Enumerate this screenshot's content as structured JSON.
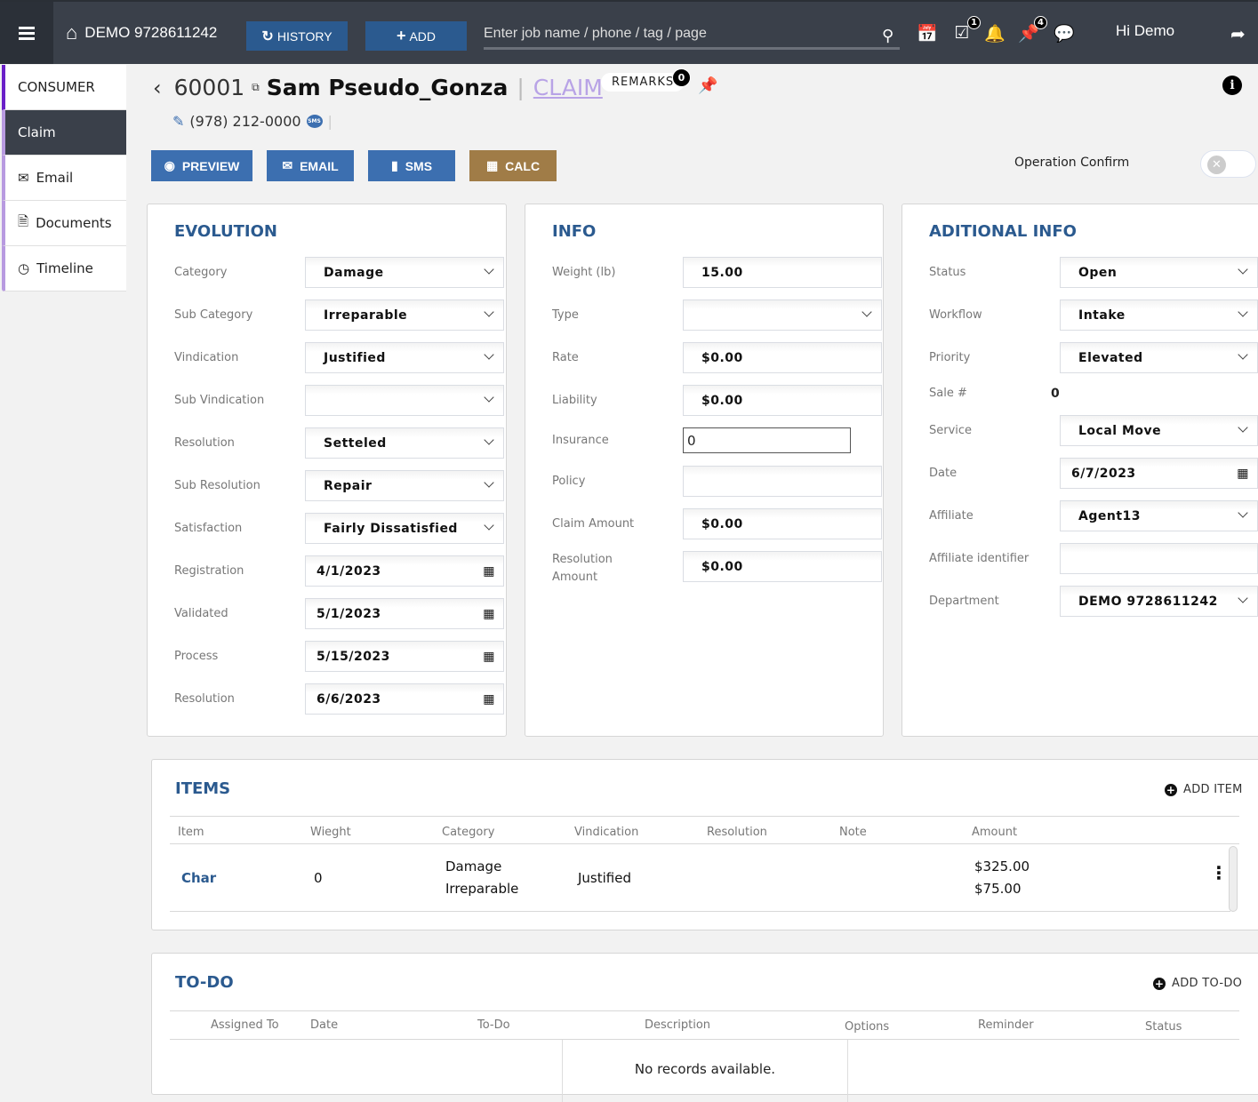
{
  "topbar": {
    "brand": "DEMO 9728611242",
    "history_label": "HISTORY",
    "add_label": "ADD",
    "search_placeholder": "Enter job name / phone / tag / page",
    "tasks_badge": "1",
    "pins_badge": "4",
    "greeting": "Hi Demo"
  },
  "sidebar": {
    "items": [
      {
        "label": "CONSUMER"
      },
      {
        "label": "Claim",
        "active": true
      },
      {
        "label": "Email",
        "icon": "envelope-icon"
      },
      {
        "label": "Documents",
        "icon": "document-icon"
      },
      {
        "label": "Timeline",
        "icon": "clock-icon"
      }
    ]
  },
  "header": {
    "job_number": "60001",
    "customer_name": "Sam Pseudo_Gonza",
    "section": "CLAIM",
    "remarks_label": "REMARKS",
    "remarks_count": "0",
    "phone": "(978) 212-0000",
    "sms_badge": "SMS"
  },
  "actions": {
    "preview": "PREVIEW",
    "email": "EMAIL",
    "sms": "SMS",
    "calc": "CALC",
    "operation_confirm_label": "Operation Confirm",
    "operation_confirm_on": false
  },
  "evolution": {
    "title": "EVOLUTION",
    "fields": [
      {
        "label": "Category",
        "value": "Damage",
        "type": "select"
      },
      {
        "label": "Sub Category",
        "value": "Irreparable",
        "type": "select"
      },
      {
        "label": "Vindication",
        "value": "Justified",
        "type": "select"
      },
      {
        "label": "Sub Vindication",
        "value": "",
        "type": "select"
      },
      {
        "label": "Resolution",
        "value": "Setteled",
        "type": "select"
      },
      {
        "label": "Sub Resolution",
        "value": "Repair",
        "type": "select"
      },
      {
        "label": "Satisfaction",
        "value": "Fairly Dissatisfied",
        "type": "select"
      },
      {
        "label": "Registration",
        "value": "4/1/2023",
        "type": "date"
      },
      {
        "label": "Validated",
        "value": "5/1/2023",
        "type": "date"
      },
      {
        "label": "Process",
        "value": "5/15/2023",
        "type": "date"
      },
      {
        "label": "Resolution",
        "value": "6/6/2023",
        "type": "date"
      }
    ]
  },
  "info": {
    "title": "INFO",
    "weight_label": "Weight (lb)",
    "weight": "15.00",
    "type_label": "Type",
    "type": "",
    "rate_label": "Rate",
    "rate": "$0.00",
    "liability_label": "Liability",
    "liability": "$0.00",
    "insurance_label": "Insurance",
    "insurance": "0",
    "policy_label": "Policy",
    "policy": "",
    "claim_amount_label": "Claim Amount",
    "claim_amount": "$0.00",
    "resolution_amount_label": "Resolution Amount",
    "resolution_amount": "$0.00"
  },
  "additional": {
    "title": "ADITIONAL INFO",
    "status_label": "Status",
    "status": "Open",
    "workflow_label": "Workflow",
    "workflow": "Intake",
    "priority_label": "Priority",
    "priority": "Elevated",
    "sale_label": "Sale #",
    "sale": "0",
    "service_label": "Service",
    "service": "Local Move",
    "date_label": "Date",
    "date": "6/7/2023",
    "affiliate_label": "Affiliate",
    "affiliate": "Agent13",
    "affiliate_id_label": "Affiliate identifier",
    "affiliate_id": "",
    "department_label": "Department",
    "department": "DEMO 9728611242"
  },
  "items": {
    "title": "ITEMS",
    "add_label": "ADD ITEM",
    "columns": [
      "Item",
      "Wieght",
      "Category",
      "Vindication",
      "Resolution",
      "Note",
      "Amount"
    ],
    "rows": [
      {
        "item": "Char",
        "weight": "0",
        "category": "Damage",
        "subcategory": "Irreparable",
        "vindication": "Justified",
        "resolution": "",
        "note": "",
        "amount": "$325.00",
        "amount2": "$75.00"
      }
    ]
  },
  "todo": {
    "title": "TO-DO",
    "add_label": "ADD TO-DO",
    "columns": [
      "Assigned To",
      "Date",
      "To-Do",
      "Description",
      "Options",
      "Reminder",
      "Status"
    ],
    "empty_text": "No records available."
  }
}
